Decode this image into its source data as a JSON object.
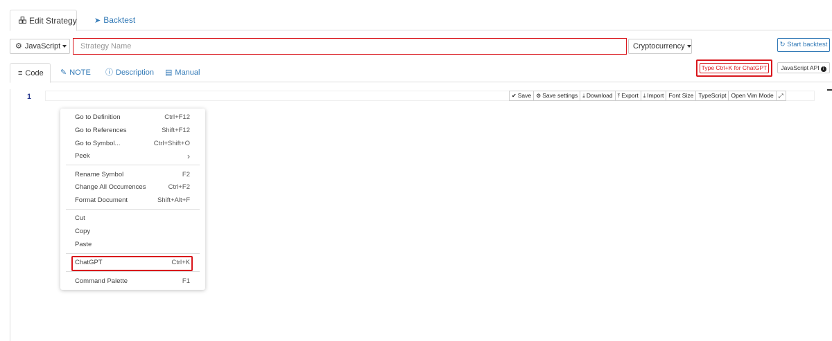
{
  "top_tabs": [
    {
      "label": "Edit Strategy",
      "icon": "cubes-icon"
    },
    {
      "label": "Backtest",
      "icon": "rocket-icon"
    }
  ],
  "toolbar": {
    "language": "JavaScript",
    "name_placeholder": "Strategy Name",
    "name_value": "",
    "market": "Cryptocurrency",
    "start_backtest": "Start backtest"
  },
  "sub_tabs": [
    {
      "label": "Code",
      "icon": "list-icon"
    },
    {
      "label": "NOTE",
      "icon": "edit-icon"
    },
    {
      "label": "Description",
      "icon": "info-circle-icon"
    },
    {
      "label": "Manual",
      "icon": "book-icon"
    }
  ],
  "chatgpt_hint": "Type Ctrl+K for ChatGPT",
  "js_api": "JavaScript API",
  "editor": {
    "line_number": "1",
    "buttons": [
      {
        "label": "Save",
        "icon": "check-icon"
      },
      {
        "label": "Save settings",
        "icon": "cog-icon"
      },
      {
        "label": "Download",
        "icon": "download-icon"
      },
      {
        "label": "Export",
        "icon": "export-icon"
      },
      {
        "label": "Import",
        "icon": "import-icon"
      },
      {
        "label": "Font Size",
        "icon": ""
      },
      {
        "label": "TypeScript",
        "icon": ""
      },
      {
        "label": "Open Vim Mode",
        "icon": ""
      }
    ],
    "fullscreen_icon": "expand-icon"
  },
  "context_menu": {
    "items": [
      {
        "label": "Go to Definition",
        "key": "Ctrl+F12"
      },
      {
        "label": "Go to References",
        "key": "Shift+F12"
      },
      {
        "label": "Go to Symbol...",
        "key": "Ctrl+Shift+O"
      },
      {
        "label": "Peek",
        "key": "›"
      },
      {
        "label": "Rename Symbol",
        "key": "F2"
      },
      {
        "label": "Change All Occurrences",
        "key": "Ctrl+F2"
      },
      {
        "label": "Format Document",
        "key": "Shift+Alt+F"
      },
      {
        "label": "Cut",
        "key": ""
      },
      {
        "label": "Copy",
        "key": ""
      },
      {
        "label": "Paste",
        "key": ""
      },
      {
        "label": "ChatGPT",
        "key": "Ctrl+K"
      },
      {
        "label": "Command Palette",
        "key": "F1"
      }
    ]
  },
  "colors": {
    "link": "#337ab7",
    "highlight": "#d9151b"
  }
}
